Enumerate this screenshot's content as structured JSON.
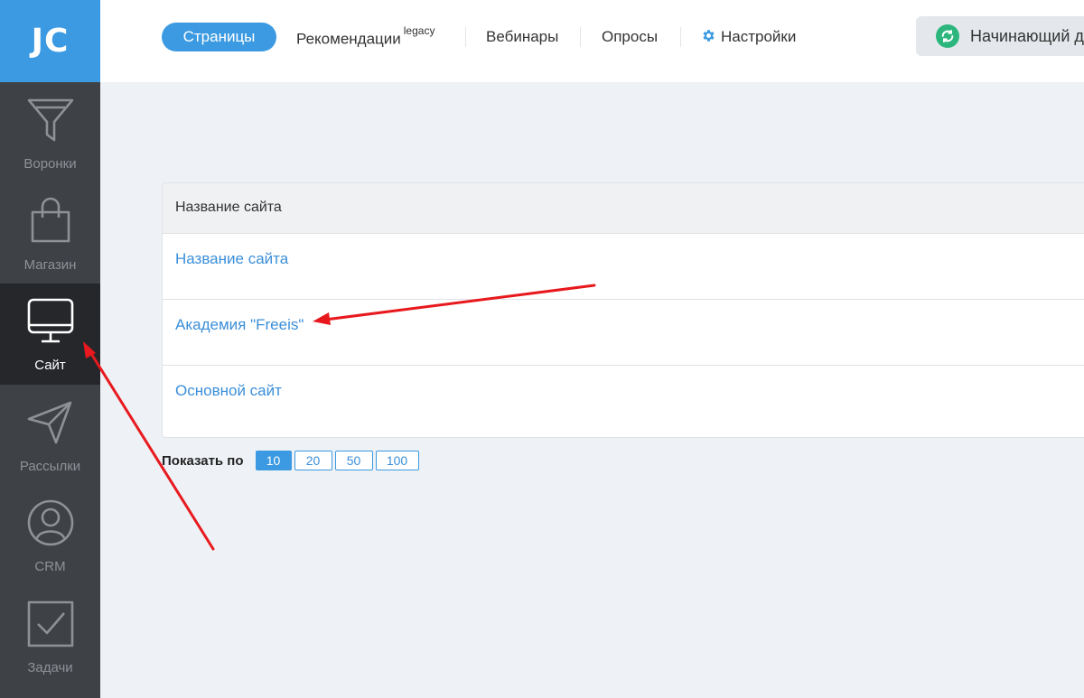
{
  "logo": "JC",
  "sidebar": {
    "items": [
      {
        "label": "Воронки",
        "icon": "funnel-icon"
      },
      {
        "label": "Магазин",
        "icon": "shopping-bag-icon"
      },
      {
        "label": "Сайт",
        "icon": "monitor-icon",
        "active": true
      },
      {
        "label": "Рассылки",
        "icon": "paper-plane-icon"
      },
      {
        "label": "CRM",
        "icon": "user-circle-icon"
      },
      {
        "label": "Задачи",
        "icon": "checkbox-icon"
      }
    ]
  },
  "topnav": {
    "tabs": [
      {
        "label": "Страницы",
        "active": true
      },
      {
        "label": "Рекомендации",
        "sup": "legacy"
      },
      {
        "label": "Вебинары"
      },
      {
        "label": "Опросы"
      },
      {
        "label": "Настройки",
        "icon": "gear-icon"
      }
    ],
    "status_button": "Начинающий д"
  },
  "table": {
    "header": "Название сайта",
    "rows": [
      "Название сайта",
      "Академия \"Freeis\"",
      "Основной сайт"
    ]
  },
  "pager": {
    "label": "Показать по",
    "options": [
      "10",
      "20",
      "50",
      "100"
    ],
    "selected": "10"
  },
  "colors": {
    "accent": "#3b9ae1",
    "sidebar_bg": "#3e4146",
    "sidebar_active": "#25272b",
    "annotation_arrow": "#e8191e",
    "refresh_green": "#2cb67d"
  }
}
